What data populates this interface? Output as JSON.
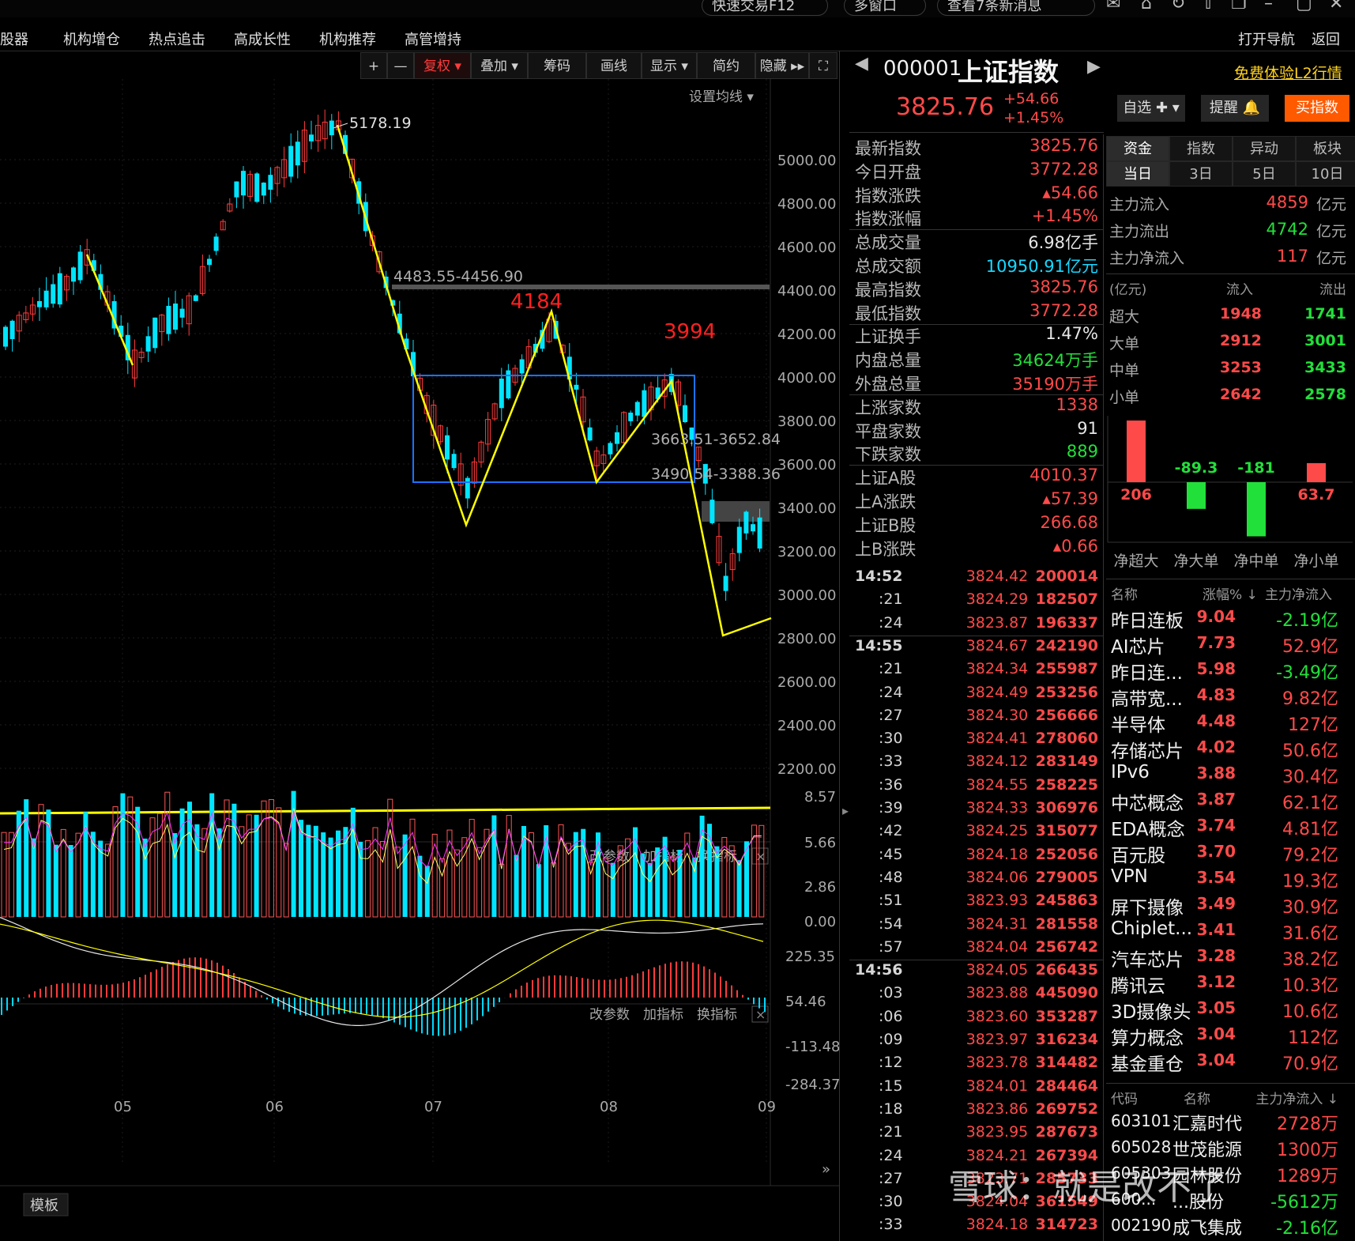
{
  "topbar": {
    "quick_trade": "快速交易F12",
    "multi_window": "多窗口",
    "messages": "查看7条新消息"
  },
  "nav": {
    "items": [
      "股器",
      "机构增仓",
      "热点追击",
      "高成长性",
      "机构推荐",
      "高管增持"
    ],
    "open_nav": "打开导航",
    "back": "返回"
  },
  "toolbar": {
    "plus": "+",
    "minus": "—",
    "fuquan": "复权 ▾",
    "overlay": "叠加 ▾",
    "chips": "筹码",
    "draw": "画线",
    "display": "显示 ▾",
    "simple": "简约",
    "hide": "隐藏 ▸▸",
    "fullscreen": "⛶",
    "ma_setting": "设置均线 ▾"
  },
  "chart": {
    "price_labels": [
      "5000.00",
      "4800.00",
      "4600.00",
      "4400.00",
      "4200.00",
      "4000.00",
      "3800.00",
      "3600.00",
      "3400.00",
      "3200.00",
      "3000.00",
      "2800.00",
      "2600.00",
      "2400.00",
      "2200.00"
    ],
    "high_label": "5178.19",
    "zone1": "4483.55-4456.90",
    "zone2": "3663.51-3652.84",
    "zone3": "3490.54-3388.36",
    "red_label1": "4184",
    "red_label2": "3994",
    "vol_panel": {
      "change_params": "改参数",
      "add_indicator": "加指标",
      "switch_indicator": "换指标",
      "close": "×",
      "labels": [
        "8.57",
        "5.66",
        "2.86",
        "0.00"
      ]
    },
    "macd_panel": {
      "change_params": "改参数",
      "add_indicator": "加指标",
      "switch_indicator": "换指标",
      "close": "×",
      "labels": [
        "225.35",
        "54.46",
        "-113.48",
        "-284.37"
      ]
    },
    "x_labels": [
      "05",
      "06",
      "07",
      "08",
      "09"
    ],
    "template_button": "模板"
  },
  "quote": {
    "code": "000001",
    "name": "上证指数",
    "price": "3825.76",
    "change": "+54.66",
    "change_pct": "+1.45%",
    "l2_link": "免费体验L2行情",
    "watch_button": "自选 ✚ ▾",
    "alert_button": "提醒 🔔",
    "buy_button": "买指数",
    "rows": [
      {
        "label": "最新指数",
        "value": "3825.76",
        "color": "red"
      },
      {
        "label": "今日开盘",
        "value": "3772.28",
        "color": "red"
      },
      {
        "label": "指数涨跌",
        "value": "▴54.66",
        "color": "red"
      },
      {
        "label": "指数涨幅",
        "value": "+1.45%",
        "color": "red"
      },
      {
        "label": "总成交量",
        "value": "6.98亿手",
        "color": "white"
      },
      {
        "label": "总成交额",
        "value": "10950.91亿元",
        "color": "cyan"
      },
      {
        "label": "最高指数",
        "value": "3825.76",
        "color": "red"
      },
      {
        "label": "最低指数",
        "value": "3772.28",
        "color": "red"
      },
      {
        "label": "上证换手",
        "value": "1.47%",
        "color": "white"
      },
      {
        "label": "内盘总量",
        "value": "34624万手",
        "color": "green"
      },
      {
        "label": "外盘总量",
        "value": "35190万手",
        "color": "red"
      },
      {
        "label": "上涨家数",
        "value": "1338",
        "color": "red"
      },
      {
        "label": "平盘家数",
        "value": "91",
        "color": "white"
      },
      {
        "label": "下跌家数",
        "value": "889",
        "color": "green"
      },
      {
        "label": "上证A股",
        "value": "4010.37",
        "color": "red"
      },
      {
        "label": "上A涨跌",
        "value": "▴57.39",
        "color": "red"
      },
      {
        "label": "上证B股",
        "value": "266.68",
        "color": "red"
      },
      {
        "label": "上B涨跌",
        "value": "▴0.66",
        "color": "red"
      }
    ]
  },
  "ticks": [
    {
      "time": "14:52",
      "price": "3824.42",
      "vol": "200014"
    },
    {
      "time": ":21",
      "price": "3824.29",
      "vol": "182507"
    },
    {
      "time": ":24",
      "price": "3823.87",
      "vol": "196337"
    },
    {
      "time": "14:55",
      "price": "3824.67",
      "vol": "242190"
    },
    {
      "time": ":21",
      "price": "3824.34",
      "vol": "255987"
    },
    {
      "time": ":24",
      "price": "3824.49",
      "vol": "253256"
    },
    {
      "time": ":27",
      "price": "3824.30",
      "vol": "256666"
    },
    {
      "time": ":30",
      "price": "3824.41",
      "vol": "278060"
    },
    {
      "time": ":33",
      "price": "3824.12",
      "vol": "283149"
    },
    {
      "time": ":36",
      "price": "3824.55",
      "vol": "258225"
    },
    {
      "time": ":39",
      "price": "3824.33",
      "vol": "306976"
    },
    {
      "time": ":42",
      "price": "3824.25",
      "vol": "315077"
    },
    {
      "time": ":45",
      "price": "3824.18",
      "vol": "252056"
    },
    {
      "time": ":48",
      "price": "3824.06",
      "vol": "279005"
    },
    {
      "time": ":51",
      "price": "3823.93",
      "vol": "245863"
    },
    {
      "time": ":54",
      "price": "3824.31",
      "vol": "281558"
    },
    {
      "time": ":57",
      "price": "3824.04",
      "vol": "256742"
    },
    {
      "time": "14:56",
      "price": "3824.05",
      "vol": "266435"
    },
    {
      "time": ":03",
      "price": "3823.88",
      "vol": "445090"
    },
    {
      "time": ":06",
      "price": "3823.60",
      "vol": "353287"
    },
    {
      "time": ":09",
      "price": "3823.97",
      "vol": "316234"
    },
    {
      "time": ":12",
      "price": "3823.78",
      "vol": "314482"
    },
    {
      "time": ":15",
      "price": "3824.01",
      "vol": "284464"
    },
    {
      "time": ":18",
      "price": "3823.86",
      "vol": "269752"
    },
    {
      "time": ":21",
      "price": "3823.95",
      "vol": "287673"
    },
    {
      "time": ":24",
      "price": "3824.21",
      "vol": "267394"
    },
    {
      "time": ":27",
      "price": "3823.71",
      "vol": "285733"
    },
    {
      "time": ":30",
      "price": "3824.04",
      "vol": "361549"
    },
    {
      "time": ":33",
      "price": "3824.18",
      "vol": "314723"
    }
  ],
  "fund": {
    "tabs_top": [
      "资金",
      "指数",
      "异动",
      "板块"
    ],
    "tabs_bottom": [
      "当日",
      "3日",
      "5日",
      "10日"
    ],
    "inflow_label": "主力流入",
    "inflow_value": "4859",
    "unit": "亿元",
    "outflow_label": "主力流出",
    "outflow_value": "4742",
    "net_label": "主力净流入",
    "net_value": "117",
    "table_header": [
      "(亿元)",
      "流入",
      "流出"
    ],
    "table": [
      {
        "name": "超大",
        "in": "1948",
        "out": "1741"
      },
      {
        "name": "大单",
        "in": "2912",
        "out": "3001"
      },
      {
        "name": "中单",
        "in": "3253",
        "out": "3433"
      },
      {
        "name": "小单",
        "in": "2642",
        "out": "2578"
      }
    ],
    "bar_values": [
      "206",
      "-89.3",
      "-181",
      "63.7"
    ],
    "bar_labels": [
      "净超大",
      "净大单",
      "净中单",
      "净小单"
    ]
  },
  "sectors": {
    "header": [
      "名称",
      "涨幅% ↓",
      "主力净流入"
    ],
    "rows": [
      {
        "name": "昨日连板",
        "chg": "9.04",
        "flow": "-2.19亿"
      },
      {
        "name": "AI芯片",
        "chg": "7.73",
        "flow": "52.9亿"
      },
      {
        "name": "昨日连...",
        "chg": "5.98",
        "flow": "-3.49亿"
      },
      {
        "name": "高带宽...",
        "chg": "4.83",
        "flow": "9.82亿"
      },
      {
        "name": "半导体",
        "chg": "4.48",
        "flow": "127亿"
      },
      {
        "name": "存储芯片",
        "chg": "4.02",
        "flow": "50.6亿"
      },
      {
        "name": "IPv6",
        "chg": "3.88",
        "flow": "30.4亿"
      },
      {
        "name": "中芯概念",
        "chg": "3.87",
        "flow": "62.1亿"
      },
      {
        "name": "EDA概念",
        "chg": "3.74",
        "flow": "4.81亿"
      },
      {
        "name": "百元股",
        "chg": "3.70",
        "flow": "79.2亿"
      },
      {
        "name": "VPN",
        "chg": "3.54",
        "flow": "19.3亿"
      },
      {
        "name": "屏下摄像",
        "chg": "3.49",
        "flow": "30.9亿"
      },
      {
        "name": "Chiplet...",
        "chg": "3.41",
        "flow": "31.6亿"
      },
      {
        "name": "汽车芯片",
        "chg": "3.28",
        "flow": "38.2亿"
      },
      {
        "name": "腾讯云",
        "chg": "3.12",
        "flow": "10.3亿"
      },
      {
        "name": "3D摄像头",
        "chg": "3.05",
        "flow": "10.6亿"
      },
      {
        "name": "算力概念",
        "chg": "3.04",
        "flow": "112亿"
      },
      {
        "name": "基金重仓",
        "chg": "3.04",
        "flow": "70.9亿"
      }
    ]
  },
  "stocks": {
    "header": [
      "代码",
      "名称",
      "主力净流入 ↓"
    ],
    "rows": [
      {
        "code": "603101",
        "name": "汇嘉时代",
        "flow": "2728万"
      },
      {
        "code": "605028",
        "name": "世茂能源",
        "flow": "1300万"
      },
      {
        "code": "605303",
        "name": "园林股份",
        "flow": "1289万"
      },
      {
        "code": "600...",
        "name": "...股份",
        "flow": "-5612万"
      },
      {
        "code": "002190",
        "name": "成飞集成",
        "flow": "-2.16亿"
      }
    ]
  },
  "watermark": "雪球：就是改不了"
}
